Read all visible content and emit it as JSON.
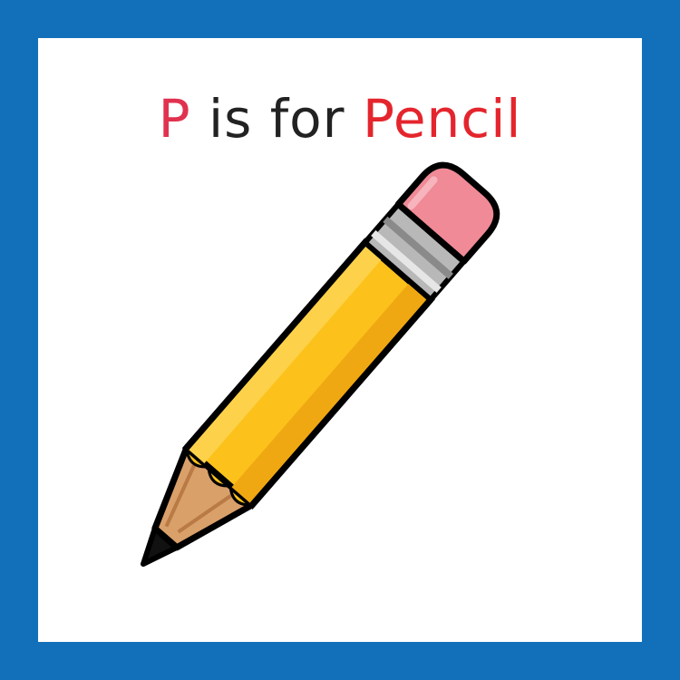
{
  "title": {
    "letter": "P",
    "middle": " is for ",
    "word": "Pencil"
  },
  "colors": {
    "border": "#1270ba",
    "letter": "#e0324f",
    "word": "#e4252d",
    "text": "#222222",
    "pencil_body": "#fcc21b",
    "eraser": "#f08a97",
    "ferrule": "#b8b8b8",
    "wood": "#d9a06a",
    "lead": "#111111"
  },
  "icons": {
    "main": "pencil-icon"
  }
}
